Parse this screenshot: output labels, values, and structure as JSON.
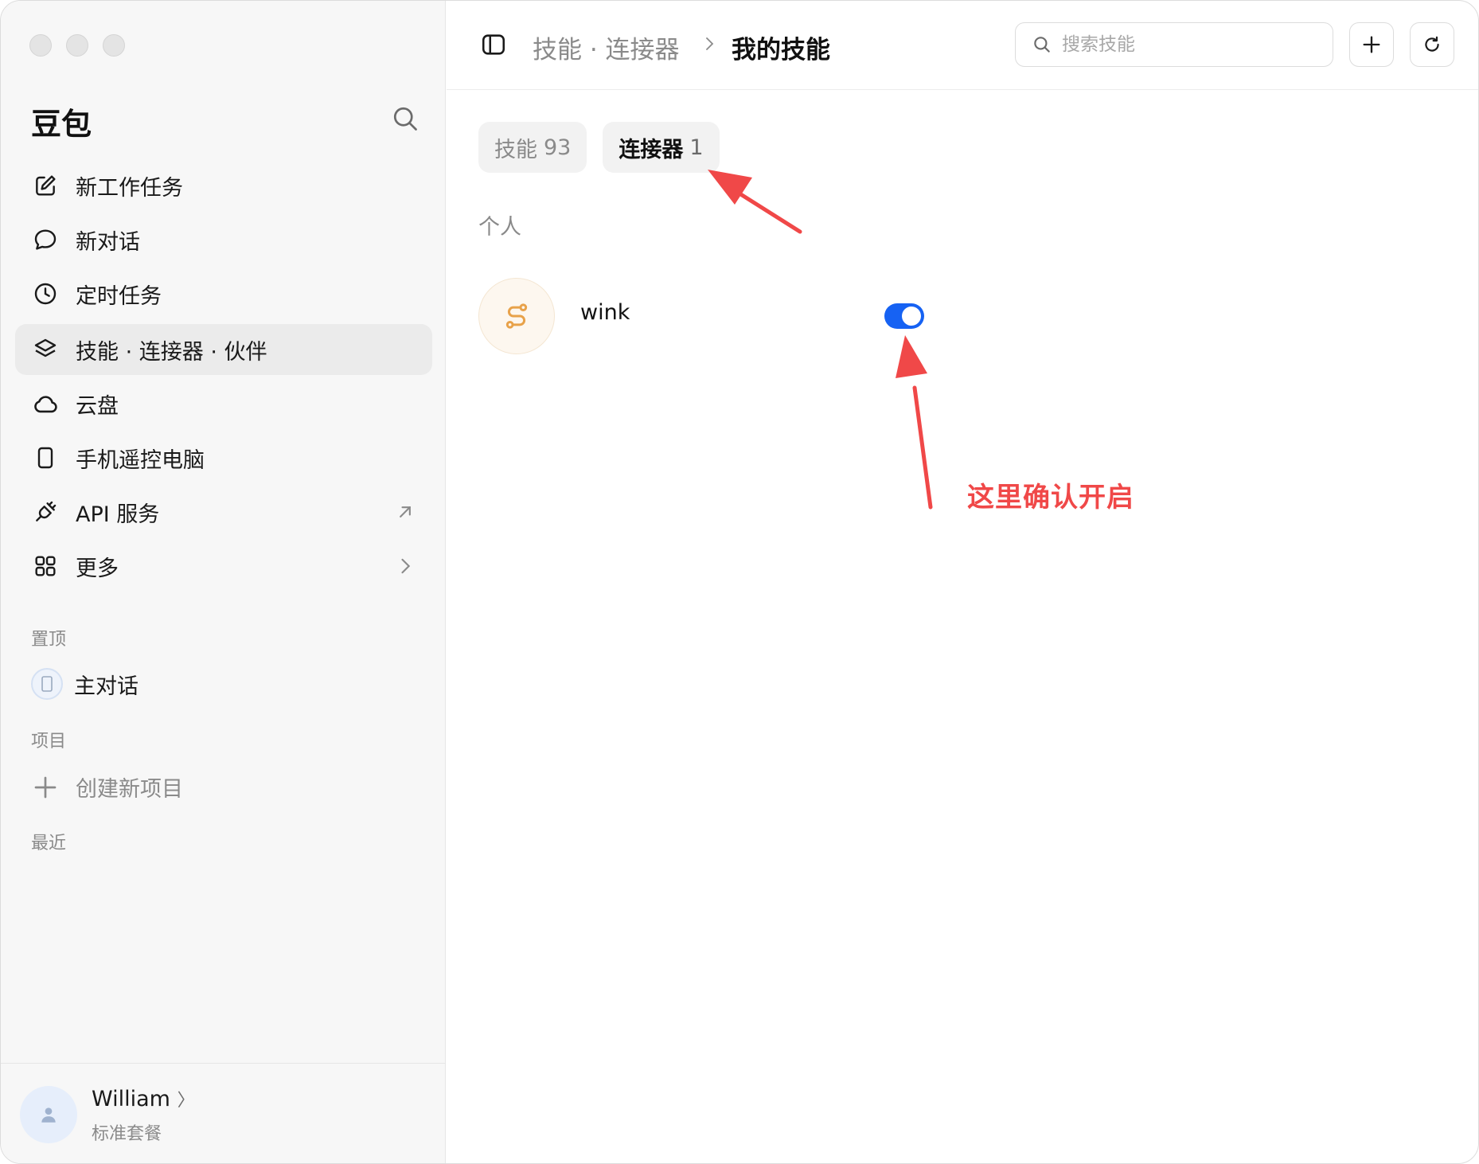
{
  "window": {
    "traffic_lights": [
      "close",
      "minimize",
      "zoom"
    ]
  },
  "sidebar": {
    "brand": "豆包",
    "items": [
      {
        "label": "新工作任务",
        "icon": "edit-icon"
      },
      {
        "label": "新对话",
        "icon": "chat-bubble-icon"
      },
      {
        "label": "定时任务",
        "icon": "clock-icon"
      },
      {
        "label": "技能 · 连接器 · 伙伴",
        "icon": "layers-icon",
        "active": true
      },
      {
        "label": "云盘",
        "icon": "cloud-icon"
      },
      {
        "label": "手机遥控电脑",
        "icon": "phone-icon"
      },
      {
        "label": "API 服务",
        "icon": "plug-icon",
        "trailing": "arrow-up-right-icon"
      },
      {
        "label": "更多",
        "icon": "grid-icon",
        "trailing": "chevron-right-icon"
      }
    ],
    "pinned_label": "置顶",
    "pinned_item": "主对话",
    "projects_label": "项目",
    "create_project": "创建新项目",
    "recent_label": "最近",
    "user": {
      "name": "William",
      "chevron": "〉",
      "plan": "标准套餐"
    }
  },
  "topbar": {
    "breadcrumb_parent": "技能 · 连接器",
    "breadcrumb_current": "我的技能",
    "search_placeholder": "搜索技能"
  },
  "tabs": [
    {
      "label": "技能",
      "count": "93",
      "active": false
    },
    {
      "label": "连接器",
      "count": "1",
      "active": true
    }
  ],
  "group_label": "个人",
  "connectors": [
    {
      "name": "wink",
      "enabled": true
    }
  ],
  "annotation": {
    "text": "这里确认开启",
    "color": "#f04848"
  },
  "colors": {
    "accent": "#1662f3",
    "annotation": "#f04848",
    "connector_icon": "#e8a24a"
  }
}
